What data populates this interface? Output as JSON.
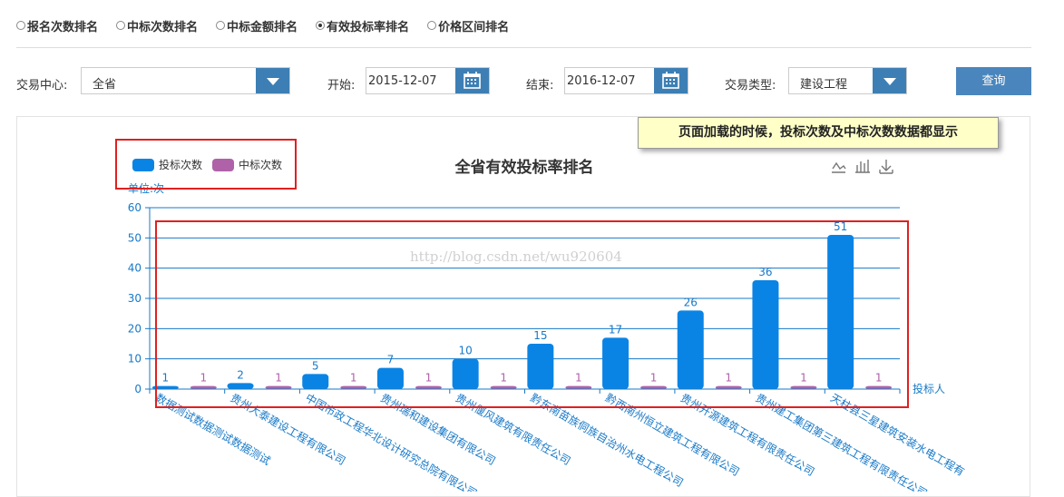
{
  "tabs": [
    {
      "label": "报名次数排名",
      "selected": false
    },
    {
      "label": "中标次数排名",
      "selected": false
    },
    {
      "label": "中标金额排名",
      "selected": false
    },
    {
      "label": "有效投标率排名",
      "selected": true
    },
    {
      "label": "价格区间排名",
      "selected": false
    }
  ],
  "filters": {
    "center_label": "交易中心:",
    "center_value": "全省",
    "start_label": "开始:",
    "start_value": "2015-12-07",
    "end_label": "结束:",
    "end_value": "2016-12-07",
    "type_label": "交易类型:",
    "type_value": "建设工程",
    "query_label": "查询"
  },
  "annotation": "页面加载的时候，投标次数及中标次数数据都显示",
  "watermark": "http://blog.csdn.net/wu920604",
  "colors": {
    "series1": "#0a84e4",
    "series2": "#b062a8",
    "axis": "#1779c8",
    "grid": "#1779c8",
    "text": "#1779c8",
    "primary": "#3d7fb5"
  },
  "toolbox": [
    "line-chart-icon",
    "bar-chart-icon",
    "download-icon"
  ],
  "chart_data": {
    "type": "bar",
    "title": "全省有效投标率排名",
    "ylabel": "单位:次",
    "xlabel": "投标人",
    "ylim": [
      0,
      60
    ],
    "yticks": [
      0,
      10,
      20,
      30,
      40,
      50,
      60
    ],
    "legend_position": "top-left",
    "grid": true,
    "categories": [
      "数据测试数据测试数据测试",
      "贵州大泰建设工程有限公司",
      "中国市政工程华北设计研究总院有限公司",
      "贵州瑞和建设集团有限公司",
      "贵州偃风建筑有限责任公司",
      "黔东南苗族侗族自治州水电工程公司",
      "黔西南州恒立建筑工程有限公司",
      "贵州开源建筑工程有限责任公司",
      "贵州建工集团第三建筑工程有限责任公司",
      "天柱县三星建筑安装水电工程有"
    ],
    "series": [
      {
        "name": "投标次数",
        "values": [
          1,
          2,
          5,
          7,
          10,
          15,
          17,
          26,
          36,
          51
        ]
      },
      {
        "name": "中标次数",
        "values": [
          1,
          1,
          1,
          1,
          1,
          1,
          1,
          1,
          1,
          1
        ]
      }
    ]
  }
}
